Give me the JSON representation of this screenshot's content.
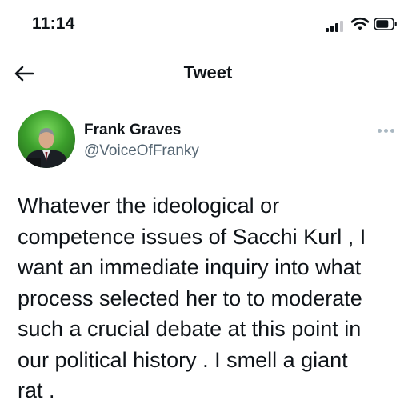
{
  "status_bar": {
    "time": "11:14",
    "icons": [
      "cellular-signal-icon",
      "wifi-icon",
      "battery-icon"
    ]
  },
  "header": {
    "back_icon": "arrow-left-icon",
    "title": "Tweet"
  },
  "author": {
    "name": "Frank Graves",
    "handle": "@VoiceOfFranky",
    "more_icon": "ellipsis-icon"
  },
  "tweet": {
    "text": "Whatever the ideological or\ncompetence issues of Sacchi Kurl , I\nwant an immediate inquiry into what\nprocess selected her to to moderate\nsuch a crucial debate at this point in\nour political history . I smell a giant\nrat ."
  },
  "colors": {
    "text_primary": "#0f1419",
    "text_secondary": "#536471",
    "more_dots": "#aab8c2"
  }
}
